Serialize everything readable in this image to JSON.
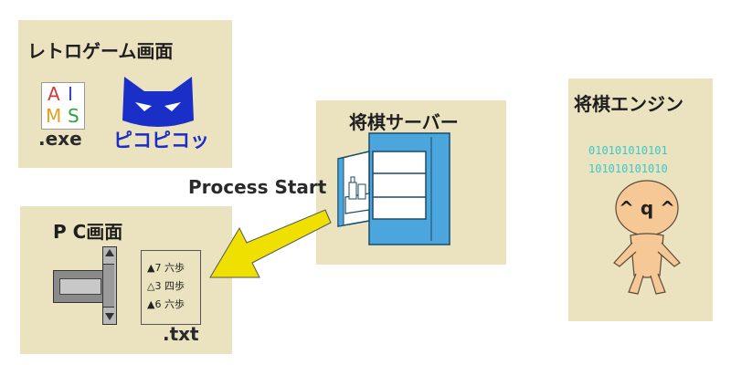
{
  "retro_panel": {
    "title": "レトロゲーム画面",
    "aims_letters": [
      "A",
      "I",
      "M",
      "S"
    ],
    "aims_ext": ".exe",
    "pikopiko_label": "ピコピコッ",
    "icons": [
      "aims-app-icon",
      "black-cat-icon"
    ]
  },
  "server_panel": {
    "title": "将棋サーバー",
    "icon": "open-refrigerator-icon"
  },
  "engine_panel": {
    "title": "将棋エンジン",
    "binary_lines": [
      "010101010101",
      "101010101010"
    ],
    "face_text": "^ q ^",
    "icon": "stick-figure-icon"
  },
  "pc_panel": {
    "title": "P C画面",
    "moves": [
      "▲7 六歩",
      "△3 四歩",
      "▲6 六歩"
    ],
    "txt_ext": ".txt",
    "scrollbar_icons": [
      "arrow-up-icon",
      "arrow-down-icon"
    ]
  },
  "arrow": {
    "label": "Process Start",
    "color": "#f0e000"
  },
  "colors": {
    "panel_bg": "#ebe2bf",
    "fridge_blue": "#4aa6dc",
    "binary_teal": "#3cc8c8",
    "figure_skin": "#f6c896",
    "cat_blue": "#1a2ec8"
  }
}
